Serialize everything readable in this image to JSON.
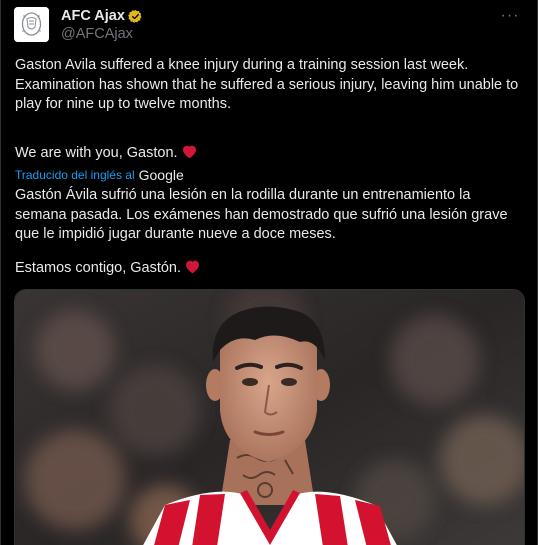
{
  "author": {
    "display_name": "AFC Ajax",
    "handle": "@AFCAjax",
    "avatar_icon": "ajax-crest-icon",
    "verified_icon": "verified-badge-icon",
    "verified_color": "#e2b719"
  },
  "menu": {
    "more_label": "···"
  },
  "tweet": {
    "text_en": "Gaston Avila suffered a knee injury during a training session last week. Examination has shown that he suffered a serious injury, leaving him unable to play for nine up to twelve months.",
    "closing_en": "We are with you, Gaston.",
    "translated_label": "Traducido del inglés al",
    "translated_brand": "Google",
    "text_es": "Gastón Ávila sufrió una lesión en la rodilla durante un entrenamiento la semana pasada. Los exámenes han demostrado que sufrió una lesión grave que le impidió jugar durante nueve a doce meses.",
    "closing_es": "Estamos contigo, Gastón.",
    "heart_icon": "red-heart-icon",
    "heart_color": "#d0163a"
  },
  "media": {
    "kit_colors": [
      "#d2122e",
      "#ffffff"
    ]
  },
  "colors": {
    "background": "#000000",
    "text_primary": "#e7e9ea",
    "text_secondary": "#71767b",
    "link": "#1d9bf0",
    "border": "#2f3336"
  }
}
